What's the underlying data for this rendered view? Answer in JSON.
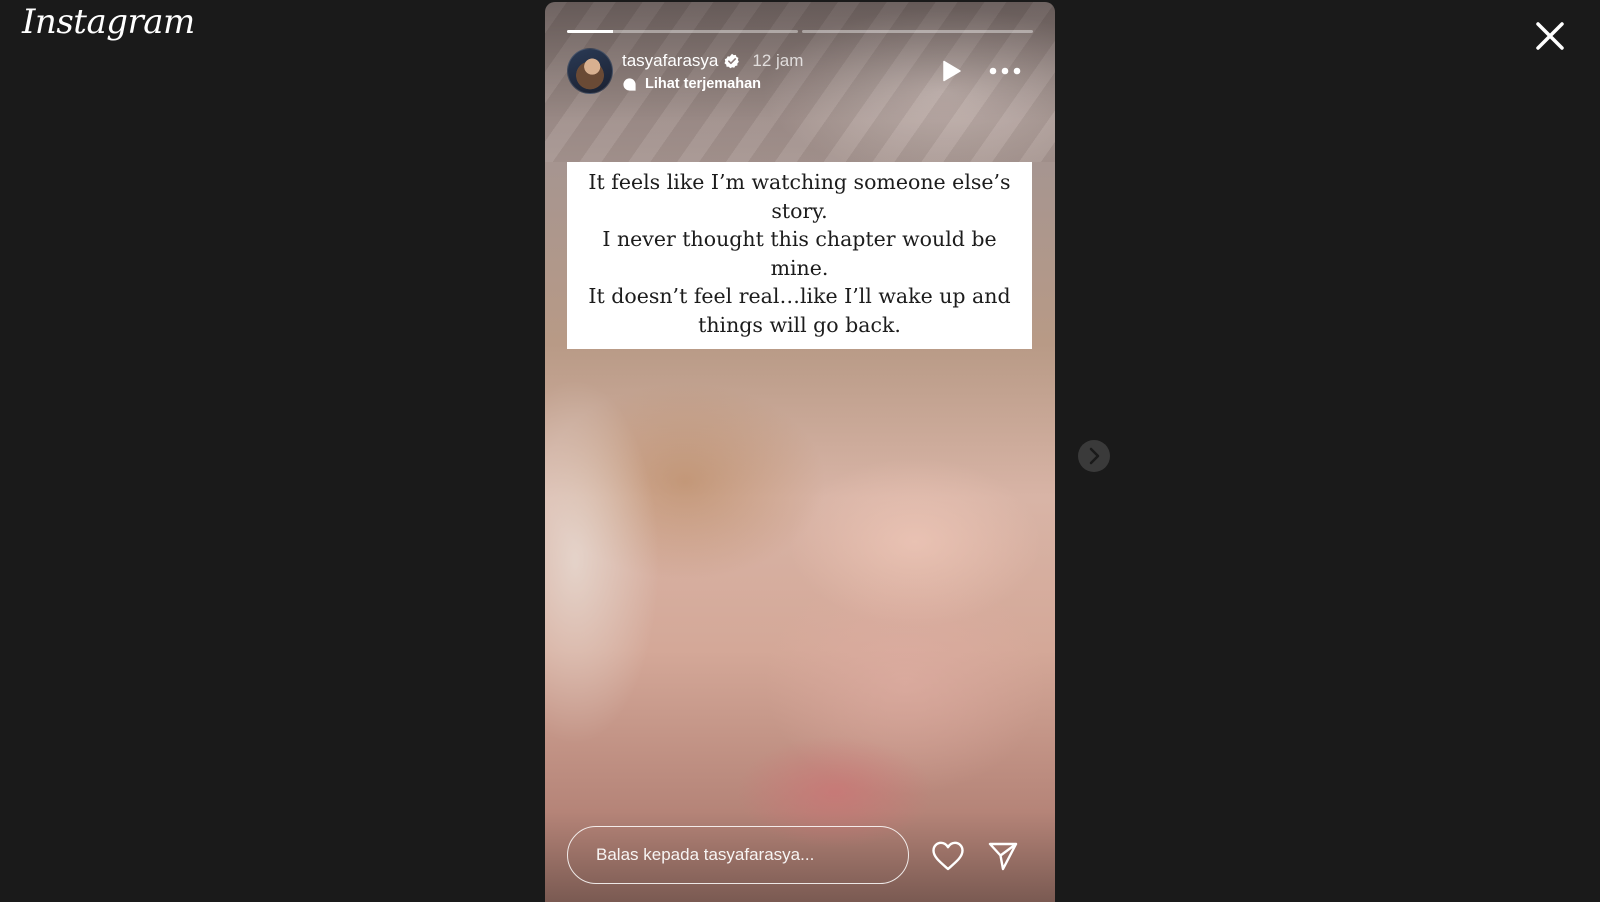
{
  "app": {
    "logo_text": "Instagram"
  },
  "story": {
    "progress": [
      0.2,
      0.0
    ],
    "user": {
      "username": "tasyafarasya",
      "verified": true,
      "time_ago": "12 jam"
    },
    "translate_label": "Lihat terjemahan",
    "caption_lines": [
      "It feels like I’m watching someone else’s",
      "story.",
      "I never thought this chapter would be",
      "mine.",
      "It doesn’t feel real…like I’ll wake up and",
      "things will go back."
    ],
    "reply": {
      "placeholder": "Balas kepada tasyafarasya..."
    }
  },
  "icons": {
    "close": "close-icon",
    "play": "play-icon",
    "more": "more-horizontal-icon",
    "verified": "verified-badge-icon",
    "translate": "translate-icon",
    "like": "heart-icon",
    "share": "send-icon",
    "next": "chevron-right-icon"
  },
  "colors": {
    "background": "#1a1a1a",
    "text": "#ffffff",
    "caption_bg": "#ffffff"
  }
}
